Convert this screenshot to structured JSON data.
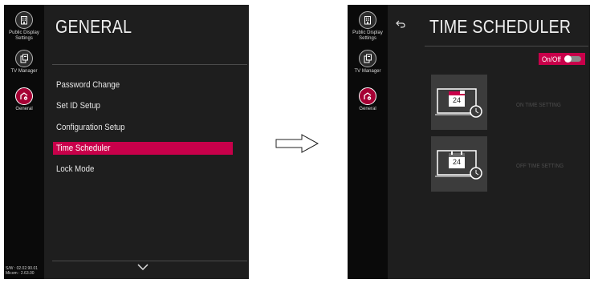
{
  "left": {
    "sidebar": {
      "items": [
        {
          "label_line1": "Public Display",
          "label_line2": "Settings",
          "icon": "building-icon"
        },
        {
          "label_line1": "TV Manager",
          "icon": "tv-manager-icon"
        },
        {
          "label_line1": "General",
          "icon": "general-icon",
          "active": true
        }
      ],
      "sw_line1": "S/W : 02.02.90.01",
      "sw_line2": "Micom : 2.63.00"
    },
    "title": "GENERAL",
    "menu": [
      {
        "label": "Password Change"
      },
      {
        "label": "Set ID Setup"
      },
      {
        "label": "Configuration Setup"
      },
      {
        "label": "Time Scheduler",
        "selected": true
      },
      {
        "label": "Lock Mode"
      }
    ],
    "scroll_icon": "chevron-down-icon"
  },
  "right": {
    "sidebar": {
      "items": [
        {
          "label_line1": "Public Display",
          "label_line2": "Settings",
          "icon": "building-icon"
        },
        {
          "label_line1": "TV Manager",
          "icon": "tv-manager-icon"
        },
        {
          "label_line1": "General",
          "icon": "general-icon",
          "active": true
        }
      ]
    },
    "title": "TIME SCHEDULER",
    "toggle_label": "On/Off",
    "on_time": {
      "label": "ON TIME SETTING",
      "day": "24"
    },
    "off_time": {
      "label": "OFF TIME SETTING",
      "day": "24"
    }
  },
  "colors": {
    "accent": "#c8004a",
    "background": "#1e1e1e",
    "sidebar": "#0a0a0a"
  }
}
